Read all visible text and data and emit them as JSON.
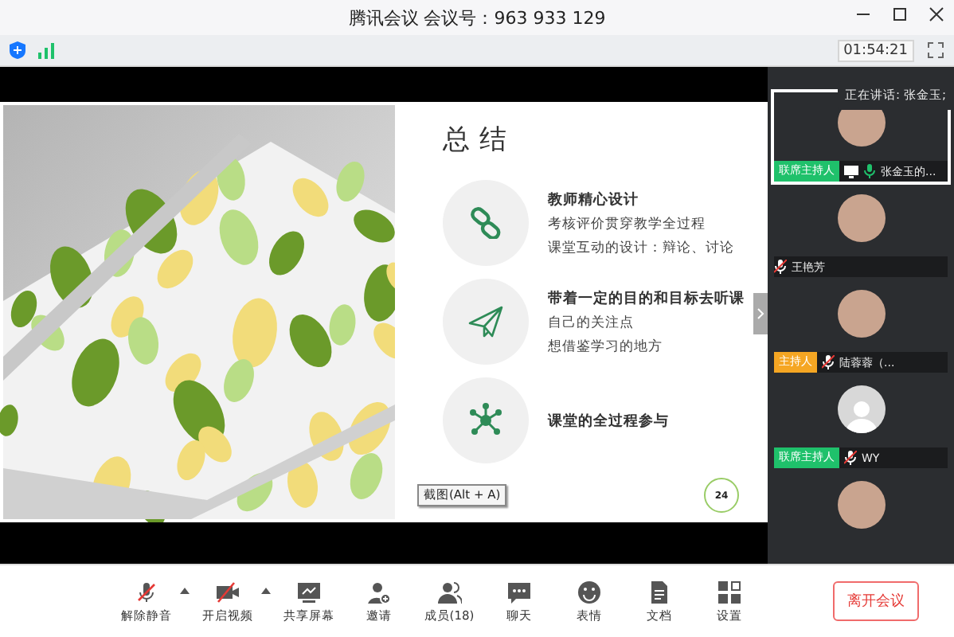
{
  "window": {
    "title": "腾讯会议 会议号：963 933 129"
  },
  "status_bar": {
    "timer": "01:54:21"
  },
  "slide": {
    "title": "总结",
    "items": [
      {
        "kind": "link",
        "heading": "教师精心设计",
        "lines": [
          "考核评价贯穿教学全过程",
          "课堂互动的设计：辩论、讨论"
        ]
      },
      {
        "kind": "plane",
        "heading": "带着一定的目的和目标去听课",
        "lines": [
          "自己的关注点",
          "想借鉴学习的地方"
        ]
      },
      {
        "kind": "network",
        "heading": "课堂的全过程参与"
      }
    ],
    "page": "24"
  },
  "screenshot_tooltip": "截图(Alt + A)",
  "speaking_tooltip": "正在讲话: 张金玉;",
  "participants": [
    {
      "kind": "photo",
      "name": "张金玉的...",
      "role": "联席主持人",
      "color": "#1fc16b",
      "muted": false,
      "sharing": true,
      "selected": true
    },
    {
      "kind": "photo",
      "name": "王艳芳",
      "muted": true,
      "sharing": false,
      "selected": false
    },
    {
      "kind": "photo",
      "name": "陆蓉蓉（...",
      "role": "主持人",
      "color": "#f5a623",
      "muted": true,
      "sharing": false,
      "selected": false
    },
    {
      "kind": "default",
      "name": "WY",
      "role": "联席主持人",
      "color": "#1fc16b",
      "muted": true,
      "sharing": false,
      "selected": false
    },
    {
      "kind": "photo",
      "selected": false
    }
  ],
  "toolbar": [
    {
      "kind": "mic-off",
      "label": "解除静音",
      "caret": true
    },
    {
      "kind": "camera-off",
      "label": "开启视频",
      "caret": true
    },
    {
      "kind": "share",
      "label": "共享屏幕",
      "caret": false
    },
    {
      "kind": "invite",
      "label": "邀请",
      "caret": false
    },
    {
      "kind": "members",
      "label": "成员(18)",
      "caret": false
    },
    {
      "kind": "chat",
      "label": "聊天",
      "caret": false
    },
    {
      "kind": "emoji",
      "label": "表情",
      "caret": false
    },
    {
      "kind": "document",
      "label": "文档",
      "caret": false
    },
    {
      "kind": "apps",
      "label": "设置",
      "caret": false
    }
  ],
  "leave_button": "离开会议"
}
